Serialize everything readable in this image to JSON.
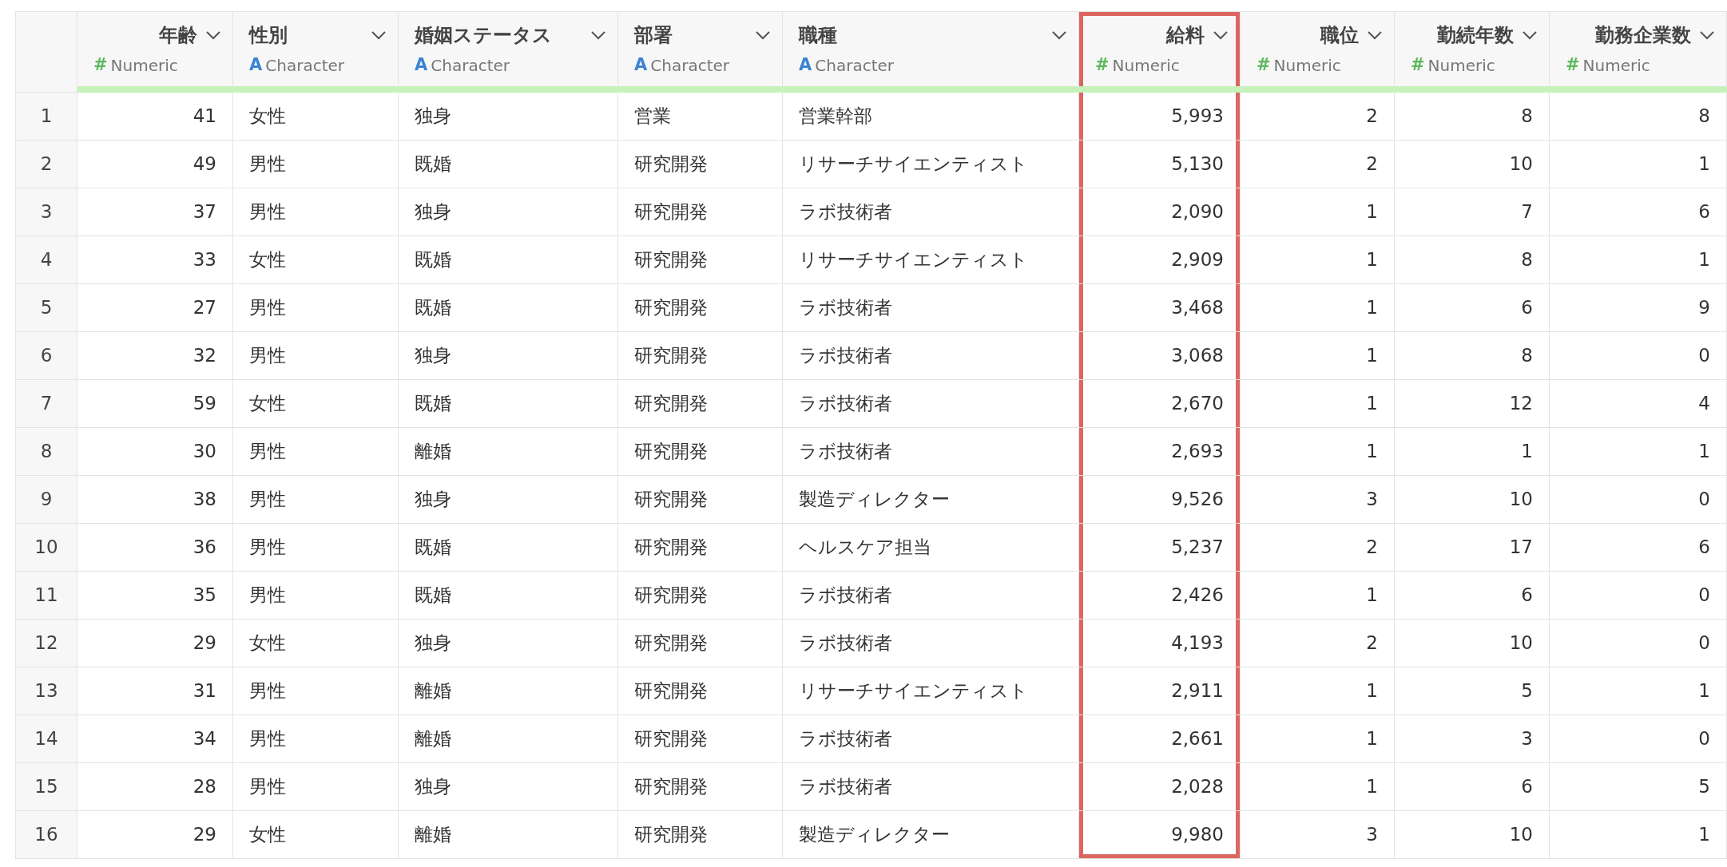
{
  "table": {
    "columns": [
      {
        "name": "年齢",
        "kind": "numeric",
        "type_icon": "#",
        "type": "Numeric",
        "selected": false
      },
      {
        "name": "性別",
        "kind": "character",
        "type_icon": "A",
        "type": "Character",
        "selected": false
      },
      {
        "name": "婚姻ステータス",
        "kind": "character",
        "type_icon": "A",
        "type": "Character",
        "selected": false
      },
      {
        "name": "部署",
        "kind": "character",
        "type_icon": "A",
        "type": "Character",
        "selected": false
      },
      {
        "name": "職種",
        "kind": "character",
        "type_icon": "A",
        "type": "Character",
        "selected": false
      },
      {
        "name": "給料",
        "kind": "numeric",
        "type_icon": "#",
        "type": "Numeric",
        "selected": true
      },
      {
        "name": "職位",
        "kind": "numeric",
        "type_icon": "#",
        "type": "Numeric",
        "selected": false
      },
      {
        "name": "勤続年数",
        "kind": "numeric",
        "type_icon": "#",
        "type": "Numeric",
        "selected": false
      },
      {
        "name": "勤務企業数",
        "kind": "numeric",
        "type_icon": "#",
        "type": "Numeric",
        "selected": false
      }
    ],
    "rows": [
      {
        "number": "1",
        "cells": [
          "41",
          "女性",
          "独身",
          "営業",
          "営業幹部",
          "5,993",
          "2",
          "8",
          "8"
        ]
      },
      {
        "number": "2",
        "cells": [
          "49",
          "男性",
          "既婚",
          "研究開発",
          "リサーチサイエンティスト",
          "5,130",
          "2",
          "10",
          "1"
        ]
      },
      {
        "number": "3",
        "cells": [
          "37",
          "男性",
          "独身",
          "研究開発",
          "ラボ技術者",
          "2,090",
          "1",
          "7",
          "6"
        ]
      },
      {
        "number": "4",
        "cells": [
          "33",
          "女性",
          "既婚",
          "研究開発",
          "リサーチサイエンティスト",
          "2,909",
          "1",
          "8",
          "1"
        ]
      },
      {
        "number": "5",
        "cells": [
          "27",
          "男性",
          "既婚",
          "研究開発",
          "ラボ技術者",
          "3,468",
          "1",
          "6",
          "9"
        ]
      },
      {
        "number": "6",
        "cells": [
          "32",
          "男性",
          "独身",
          "研究開発",
          "ラボ技術者",
          "3,068",
          "1",
          "8",
          "0"
        ]
      },
      {
        "number": "7",
        "cells": [
          "59",
          "女性",
          "既婚",
          "研究開発",
          "ラボ技術者",
          "2,670",
          "1",
          "12",
          "4"
        ]
      },
      {
        "number": "8",
        "cells": [
          "30",
          "男性",
          "離婚",
          "研究開発",
          "ラボ技術者",
          "2,693",
          "1",
          "1",
          "1"
        ]
      },
      {
        "number": "9",
        "cells": [
          "38",
          "男性",
          "独身",
          "研究開発",
          "製造ディレクター",
          "9,526",
          "3",
          "10",
          "0"
        ]
      },
      {
        "number": "10",
        "cells": [
          "36",
          "男性",
          "既婚",
          "研究開発",
          "ヘルスケア担当",
          "5,237",
          "2",
          "17",
          "6"
        ]
      },
      {
        "number": "11",
        "cells": [
          "35",
          "男性",
          "既婚",
          "研究開発",
          "ラボ技術者",
          "2,426",
          "1",
          "6",
          "0"
        ]
      },
      {
        "number": "12",
        "cells": [
          "29",
          "女性",
          "独身",
          "研究開発",
          "ラボ技術者",
          "4,193",
          "2",
          "10",
          "0"
        ]
      },
      {
        "number": "13",
        "cells": [
          "31",
          "男性",
          "離婚",
          "研究開発",
          "リサーチサイエンティスト",
          "2,911",
          "1",
          "5",
          "1"
        ]
      },
      {
        "number": "14",
        "cells": [
          "34",
          "男性",
          "離婚",
          "研究開発",
          "ラボ技術者",
          "2,661",
          "1",
          "3",
          "0"
        ]
      },
      {
        "number": "15",
        "cells": [
          "28",
          "男性",
          "独身",
          "研究開発",
          "ラボ技術者",
          "2,028",
          "1",
          "6",
          "5"
        ]
      },
      {
        "number": "16",
        "cells": [
          "29",
          "女性",
          "離婚",
          "研究開発",
          "製造ディレクター",
          "9,980",
          "3",
          "10",
          "1"
        ]
      }
    ]
  }
}
